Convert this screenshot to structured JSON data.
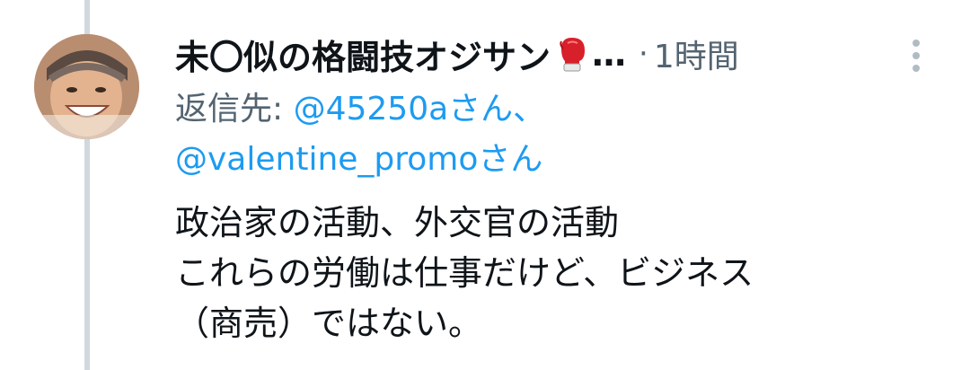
{
  "tweet": {
    "display_name": "未〇似の格闘技オジサン",
    "name_emoji": "boxing-glove-icon",
    "truncation": "…",
    "separator": "·",
    "time": "1時間",
    "reply_prefix": "返信先: ",
    "mentions": [
      "@45250aさん、",
      "@valentine_promoさん"
    ],
    "body_lines": [
      "政治家の活動、外交官の活動",
      "これらの労働は仕事だけど、ビジネス",
      "（商売）ではない。"
    ]
  },
  "colors": {
    "text": "#0f1419",
    "secondary": "#536471",
    "link": "#1d9bf0",
    "thread_line": "#cfd9de"
  }
}
